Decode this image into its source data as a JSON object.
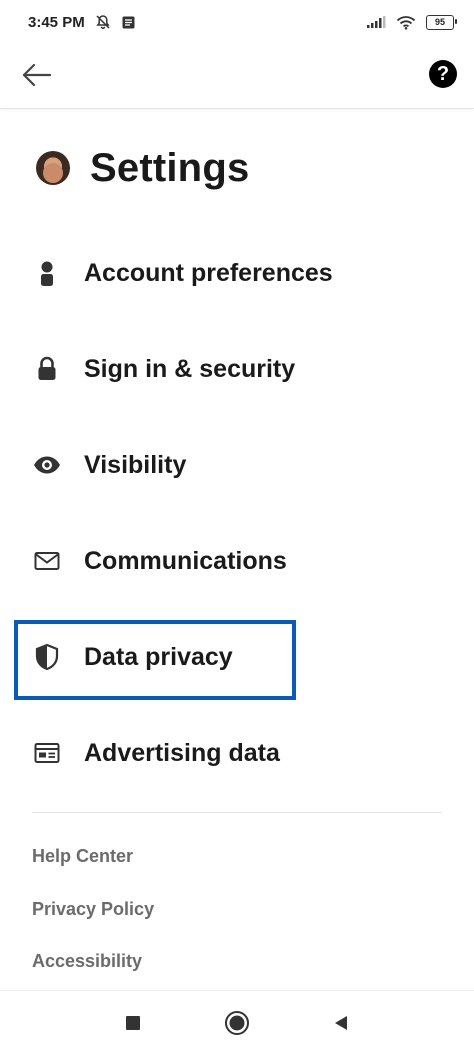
{
  "status_bar": {
    "time": "3:45 PM",
    "battery": "95",
    "icons": [
      "bell-off-icon",
      "message-icon",
      "signal-icon",
      "wifi-icon",
      "battery-icon"
    ]
  },
  "app_bar": {
    "back_icon": "arrow-left-icon",
    "help_label": "?"
  },
  "header": {
    "title": "Settings"
  },
  "menu": {
    "items": [
      {
        "label": "Account preferences",
        "icon": "person-icon"
      },
      {
        "label": "Sign in & security",
        "icon": "lock-icon"
      },
      {
        "label": "Visibility",
        "icon": "eye-icon"
      },
      {
        "label": "Communications",
        "icon": "envelope-icon"
      },
      {
        "label": "Data privacy",
        "icon": "shield-icon"
      },
      {
        "label": "Advertising data",
        "icon": "ad-card-icon"
      }
    ],
    "highlight_color": "#0a5bb5"
  },
  "footer": {
    "links": [
      "Help Center",
      "Privacy Policy",
      "Accessibility"
    ]
  },
  "nav_bar": {
    "icons": [
      "square-icon",
      "circle-home-icon",
      "triangle-back-icon"
    ]
  }
}
